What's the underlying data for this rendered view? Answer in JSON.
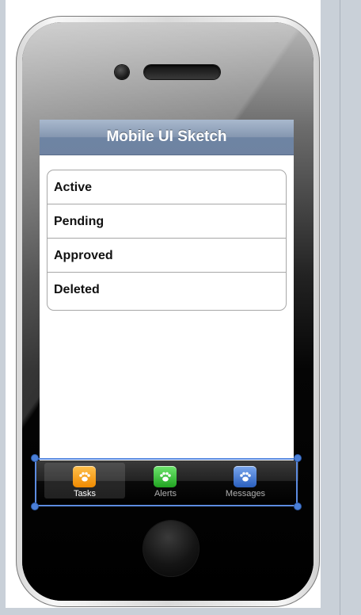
{
  "nav": {
    "title": "Mobile UI Sketch"
  },
  "list": {
    "items": [
      {
        "label": "Active"
      },
      {
        "label": "Pending"
      },
      {
        "label": "Approved"
      },
      {
        "label": "Deleted"
      }
    ]
  },
  "tabbar": {
    "tabs": [
      {
        "label": "Tasks",
        "icon": "paw-icon",
        "color": "#f08a00",
        "selected": true
      },
      {
        "label": "Alerts",
        "icon": "paw-icon",
        "color": "#2bb52b",
        "selected": false
      },
      {
        "label": "Messages",
        "icon": "paw-icon",
        "color": "#2e68c8",
        "selected": false
      }
    ]
  },
  "colors": {
    "navbar": "#7f93b0",
    "selection": "#5c8be0",
    "background": "#c9d0d8"
  }
}
